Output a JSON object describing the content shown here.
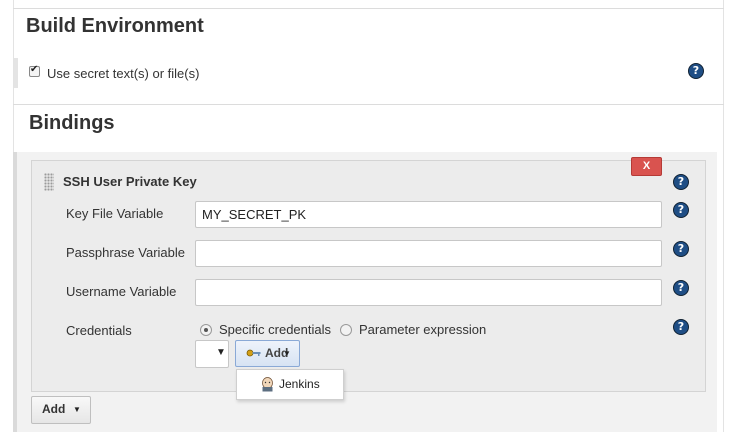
{
  "build_environment": {
    "title": "Build Environment",
    "use_secret_label": "Use secret text(s) or file(s)"
  },
  "bindings": {
    "title": "Bindings",
    "binding_type": "SSH User Private Key",
    "remove_label": "X",
    "key_file_variable": {
      "label": "Key File Variable",
      "value": "MY_SECRET_PK"
    },
    "passphrase_variable": {
      "label": "Passphrase Variable",
      "value": ""
    },
    "username_variable": {
      "label": "Username Variable",
      "value": ""
    },
    "credentials": {
      "label": "Credentials",
      "option_specific": "Specific credentials",
      "option_parameter": "Parameter expression",
      "selected": "Specific credentials",
      "select_value": "",
      "add_label": "Add",
      "add_menu_items": [
        "Jenkins"
      ]
    },
    "add_binding_label": "Add"
  },
  "icons": {
    "help": "help-icon",
    "checkbox": "checkbox-checked-icon",
    "grip": "drag-handle-icon",
    "key": "key-icon",
    "jenkins": "jenkins-icon"
  },
  "colors": {
    "remove_button": "#d9534f",
    "help_icon": "#1f4e85",
    "add_key_button": "#d7e3f3"
  }
}
